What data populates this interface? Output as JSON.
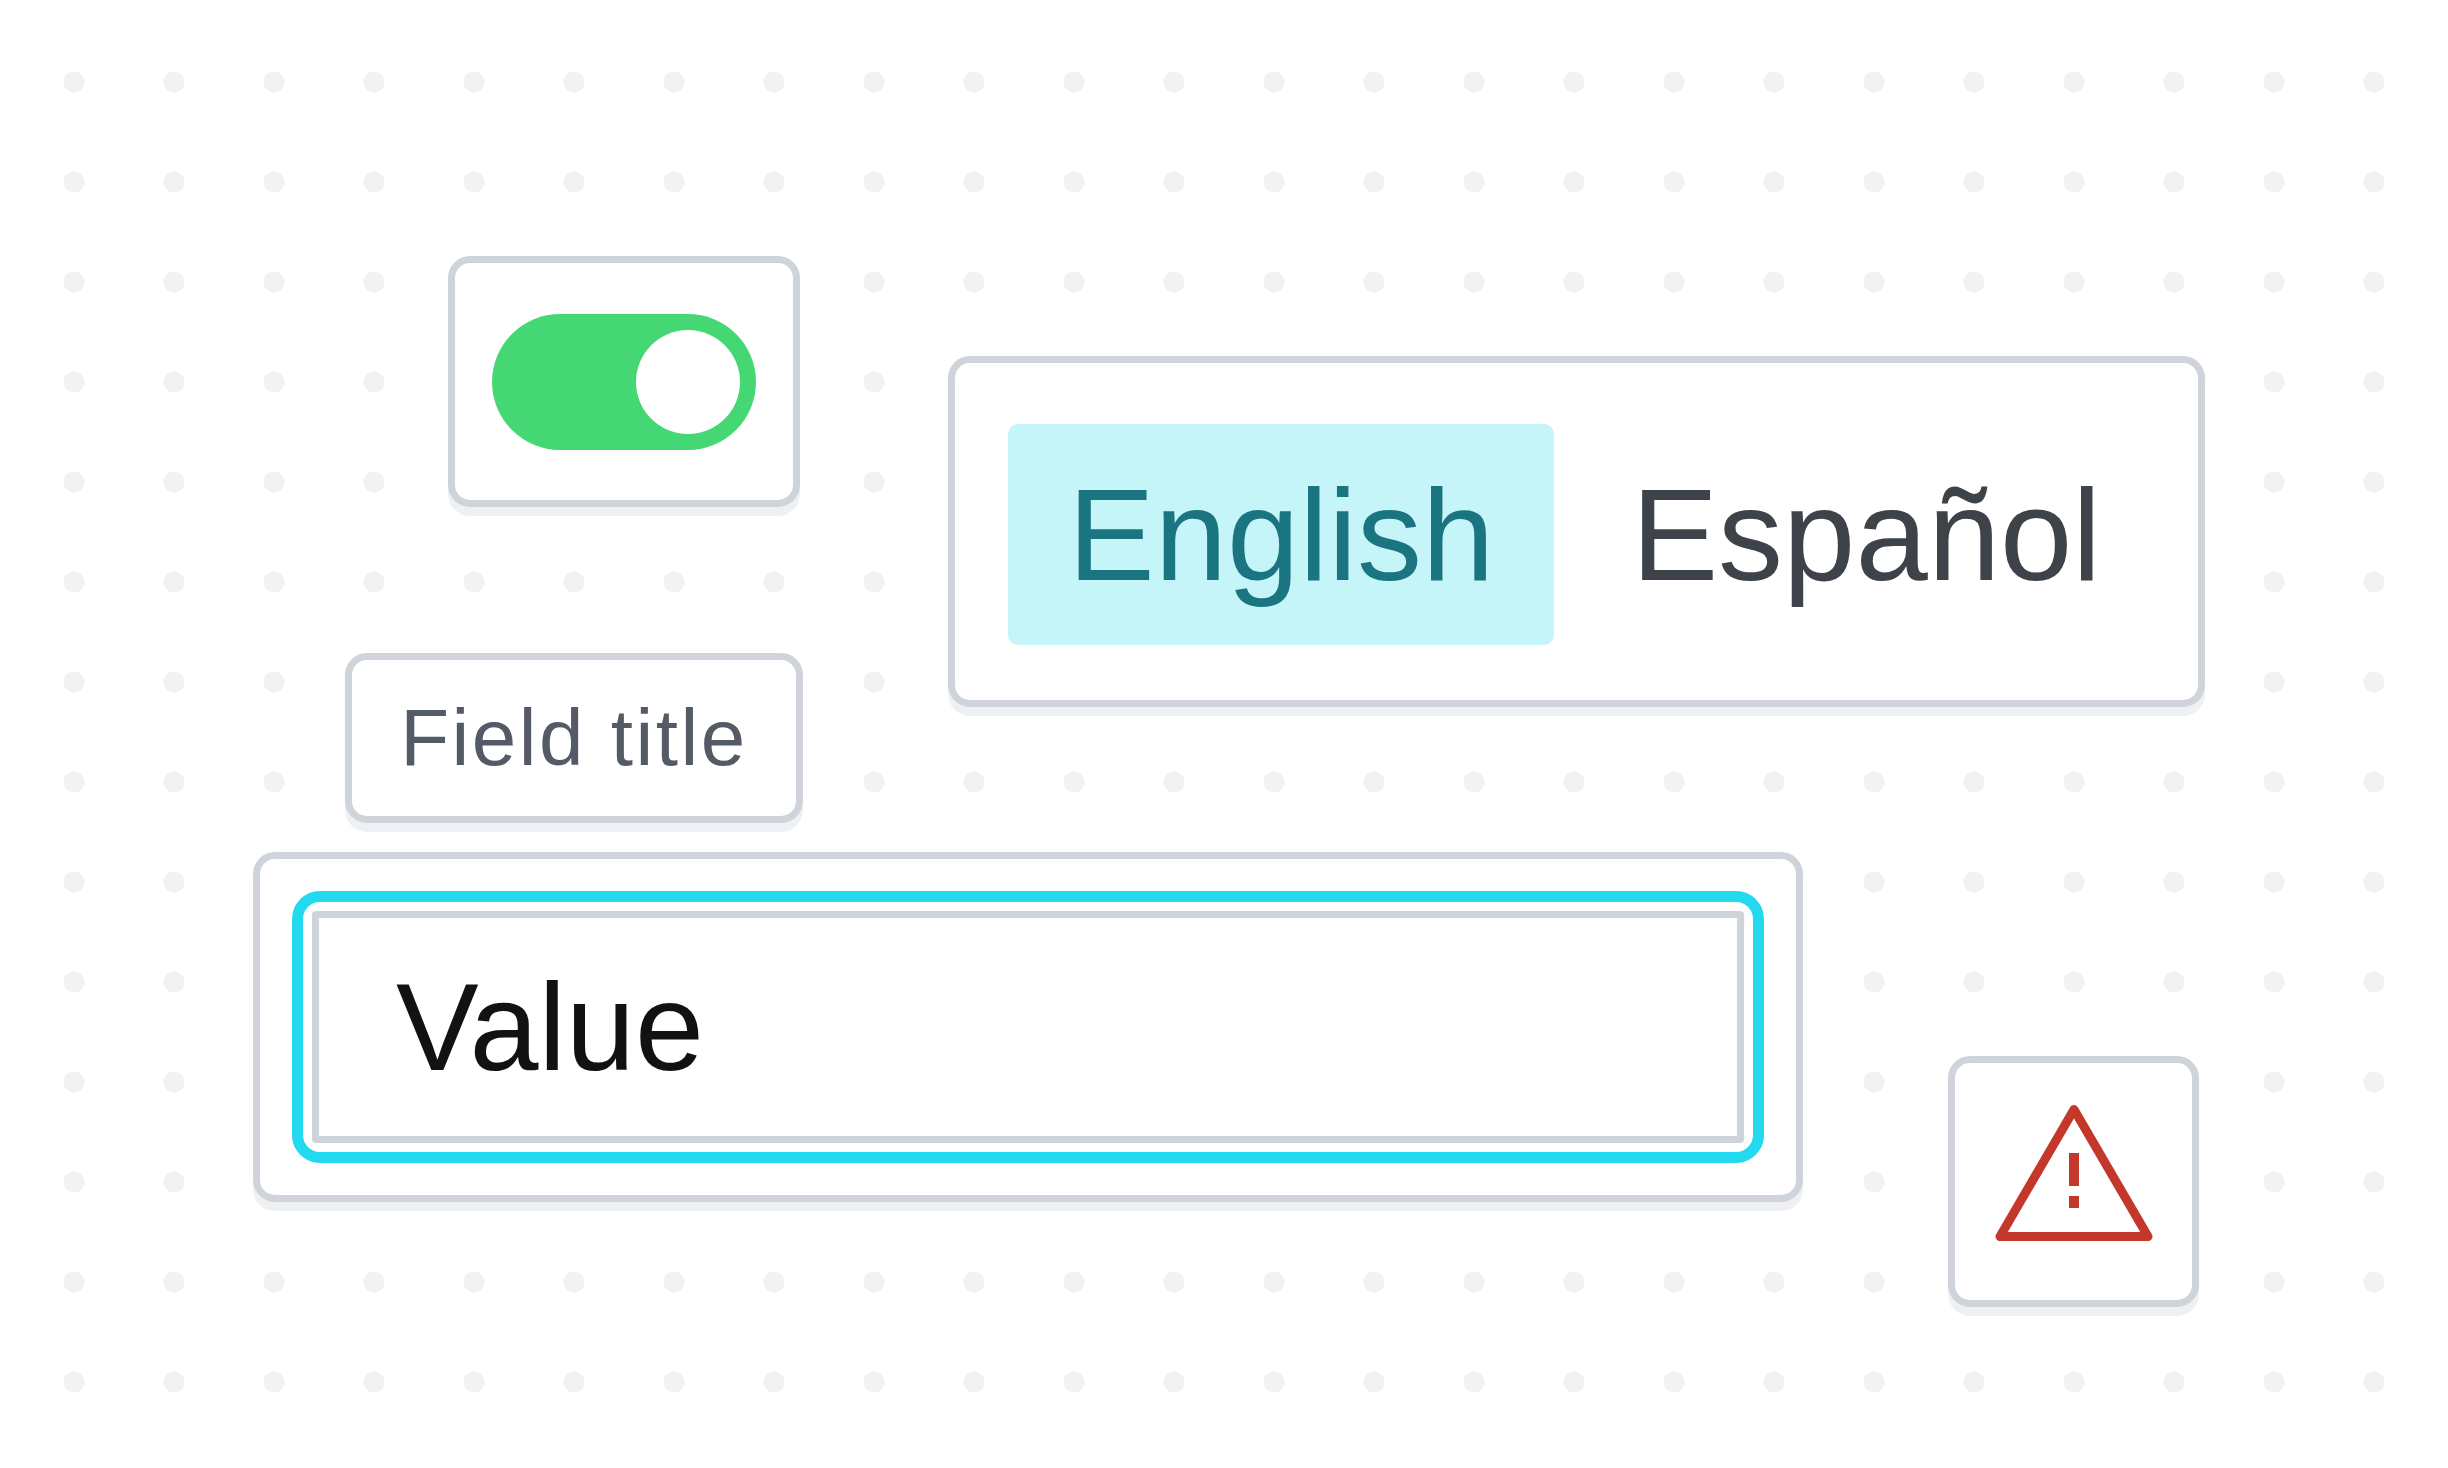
{
  "toggle": {
    "on": true
  },
  "language_switcher": {
    "options": [
      {
        "label": "English",
        "selected": true
      },
      {
        "label": "Español",
        "selected": false
      }
    ]
  },
  "field": {
    "title": "Field title",
    "value": "Value",
    "focused": true
  }
}
